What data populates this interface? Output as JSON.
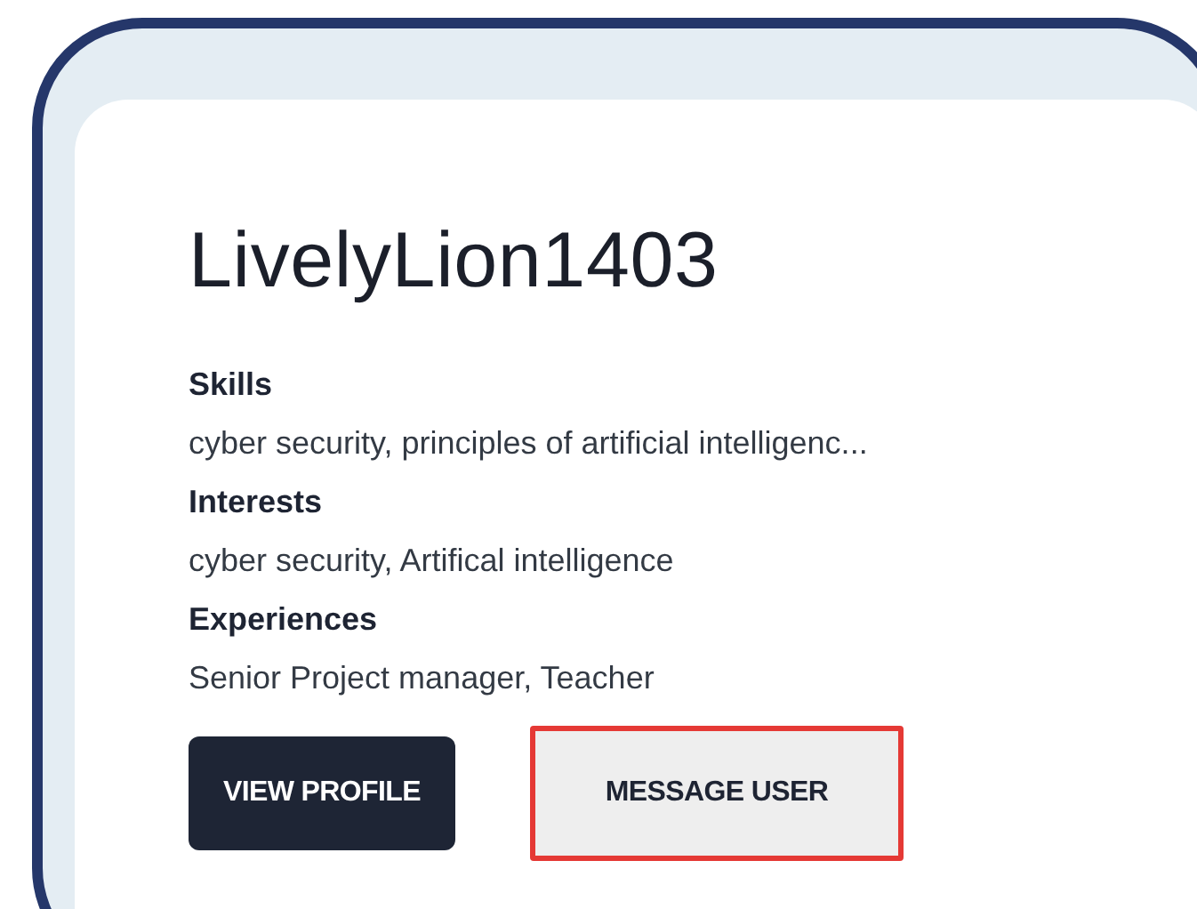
{
  "profile": {
    "username": "LivelyLion1403",
    "sections": [
      {
        "label": "Skills",
        "value": "cyber security, principles of artificial intelligenc..."
      },
      {
        "label": "Interests",
        "value": "cyber security, Artifical intelligence"
      },
      {
        "label": "Experiences",
        "value": "Senior Project manager, Teacher"
      }
    ],
    "buttons": [
      {
        "label": "VIEW PROFILE",
        "kind": "primary",
        "highlighted": false
      },
      {
        "label": "MESSAGE USER",
        "kind": "secondary",
        "highlighted": true
      }
    ]
  }
}
